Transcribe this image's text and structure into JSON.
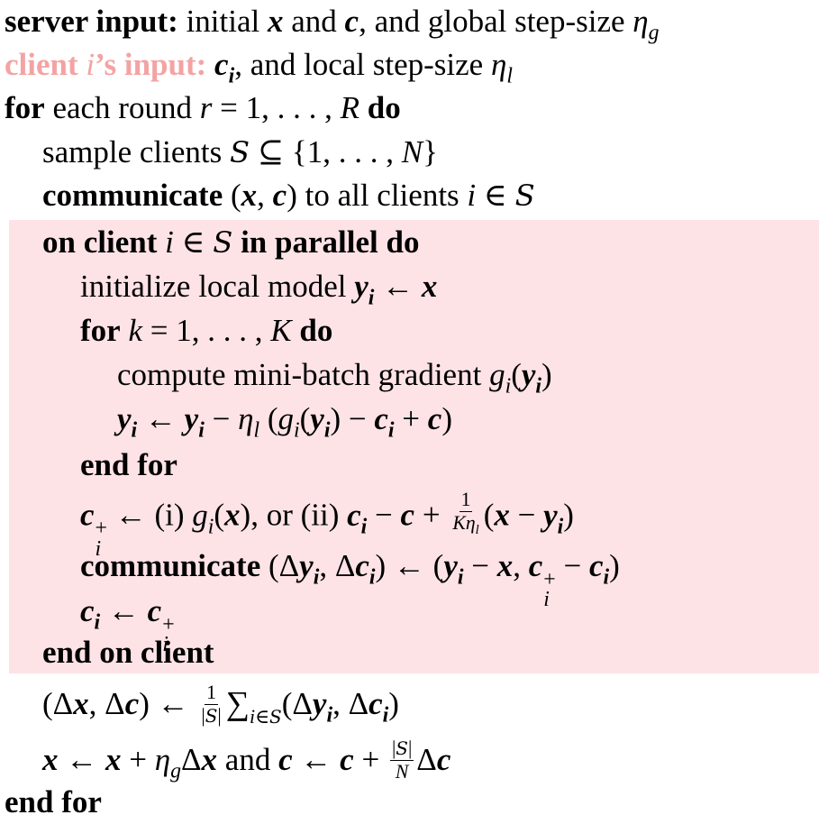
{
  "algorithm": {
    "server_input_kw": "server input:",
    "server_input_text": " initial ",
    "and1": " and ",
    "server_input_tail": ", and global step-size ",
    "client_input_kw_a": "client ",
    "client_input_kw_b": "’s input:",
    "client_input_tail": ", and local step-size ",
    "for_kw": "for",
    "each_round": " each round ",
    "round_eq": " = 1, . . . , ",
    "do_kw": "do",
    "sample_clients": "sample clients ",
    "subseteq": " ⊆ {1, . . . , ",
    "close_brace": "}",
    "communicate_kw": "communicate",
    "to_all_clients": " to all clients ",
    "in_sym": " ∈ ",
    "on_client_kw": "on client ",
    "in_parallel_kw": " in parallel do",
    "initialize": "initialize local model ",
    "arrow": " ← ",
    "k_eq": " = 1, . . . , ",
    "compute": "compute mini-batch gradient ",
    "end_for_kw": "end for",
    "or_i": " (i) ",
    "or_ii": ", or (ii) ",
    "end_on_client_kw": "end on client",
    "and2": " and ",
    "end_for_final_kw": "end for"
  }
}
